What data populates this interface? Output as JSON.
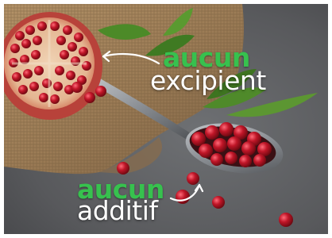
{
  "captions": {
    "top_accent": "aucun",
    "top_main": "excipient",
    "bottom_accent": "aucun",
    "bottom_main": "additif"
  },
  "colors": {
    "accent": "#37c14e",
    "text": "#ffffff",
    "stone": "#5b5d60",
    "burlap": "#9b7d59",
    "pomegranate_skin": "#c0443a",
    "aril": "#a3101e",
    "leaf": "#4f8a2a",
    "spoon": "#7b7e82"
  }
}
